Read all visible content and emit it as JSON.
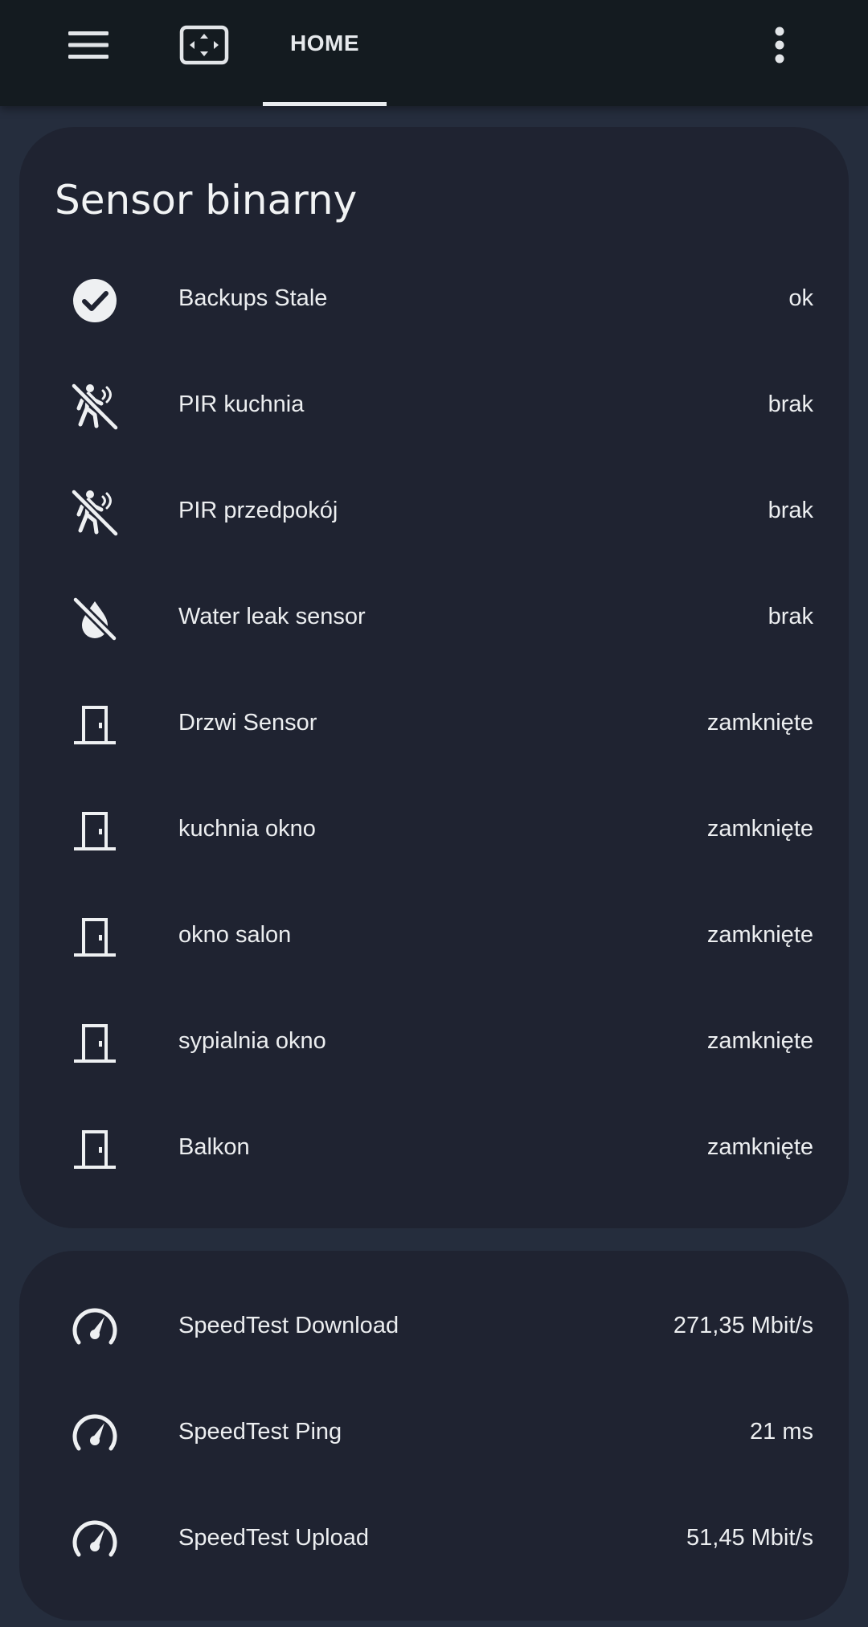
{
  "topbar": {
    "icons": {
      "menu": "hamburger-icon",
      "fit": "fullscreen-fit-icon",
      "more": "more-vertical-icon"
    },
    "tab_home": "HOME"
  },
  "binary_card": {
    "title": "Sensor binarny",
    "rows": [
      {
        "icon": "check-circle-icon",
        "name": "Backups Stale",
        "state": "ok"
      },
      {
        "icon": "motion-sensor-off-icon",
        "name": "PIR kuchnia",
        "state": "brak"
      },
      {
        "icon": "motion-sensor-off-icon",
        "name": "PIR przedpokój",
        "state": "brak"
      },
      {
        "icon": "water-off-icon",
        "name": "Water leak sensor",
        "state": "brak"
      },
      {
        "icon": "door-closed-icon",
        "name": "Drzwi Sensor",
        "state": "zamknięte"
      },
      {
        "icon": "door-closed-icon",
        "name": "kuchnia okno",
        "state": "zamknięte"
      },
      {
        "icon": "door-closed-icon",
        "name": "okno salon",
        "state": "zamknięte"
      },
      {
        "icon": "door-closed-icon",
        "name": "sypialnia okno",
        "state": "zamknięte"
      },
      {
        "icon": "door-closed-icon",
        "name": "Balkon",
        "state": "zamknięte"
      }
    ]
  },
  "speed_card": {
    "rows": [
      {
        "icon": "speedometer-icon",
        "name": "SpeedTest Download",
        "state": "271,35 Mbit/s"
      },
      {
        "icon": "speedometer-icon",
        "name": "SpeedTest Ping",
        "state": "21 ms"
      },
      {
        "icon": "speedometer-icon",
        "name": "SpeedTest Upload",
        "state": "51,45 Mbit/s"
      }
    ]
  },
  "colors": {
    "topbar_bg": "#141b20",
    "page_bg": "#252d3d",
    "card_bg": "#1f2331",
    "text": "#eceef0"
  }
}
